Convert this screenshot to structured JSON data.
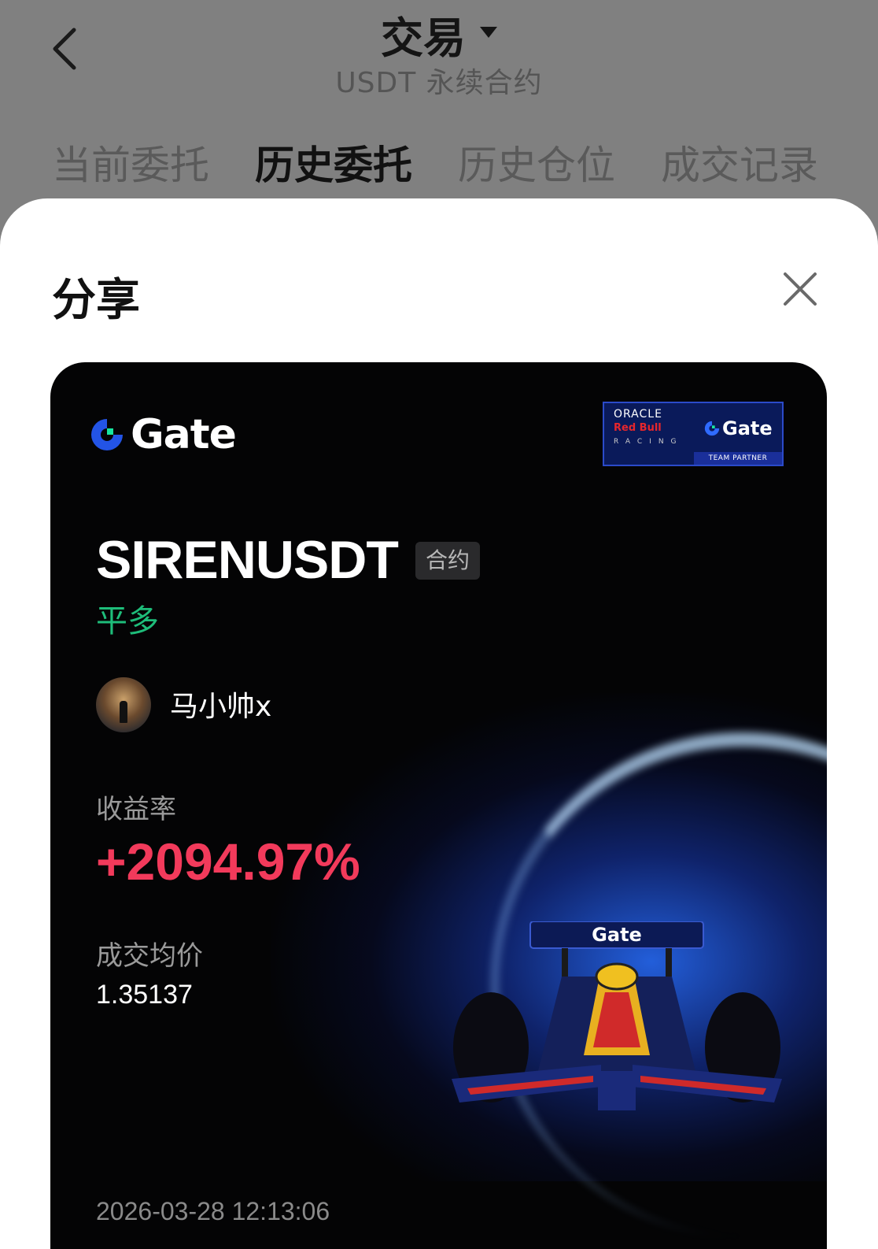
{
  "header": {
    "title": "交易",
    "subtitle": "USDT 永续合约",
    "tabs": [
      {
        "label": "当前委托",
        "active": false
      },
      {
        "label": "历史委托",
        "active": true
      },
      {
        "label": "历史仓位",
        "active": false
      },
      {
        "label": "成交记录",
        "active": false
      }
    ]
  },
  "sheet": {
    "title": "分享"
  },
  "card": {
    "brand": "Gate",
    "partner": {
      "line1": "ORACLE",
      "line2": "Red Bull",
      "line3": "RACING",
      "brand": "Gate",
      "tag": "TEAM PARTNER"
    },
    "symbol": "SIRENUSDT",
    "badge": "合约",
    "direction": "平多",
    "username": "马小帅x",
    "roi_label": "收益率",
    "roi_value": "+2094.97%",
    "avg_price_label": "成交均价",
    "avg_price_value": "1.35137",
    "timestamp": "2026-03-28 12:13:06"
  },
  "colors": {
    "profit": "#f23a5b",
    "long": "#1ebd7a",
    "brand_blue": "#2354e6",
    "brand_green": "#17e6a1"
  }
}
